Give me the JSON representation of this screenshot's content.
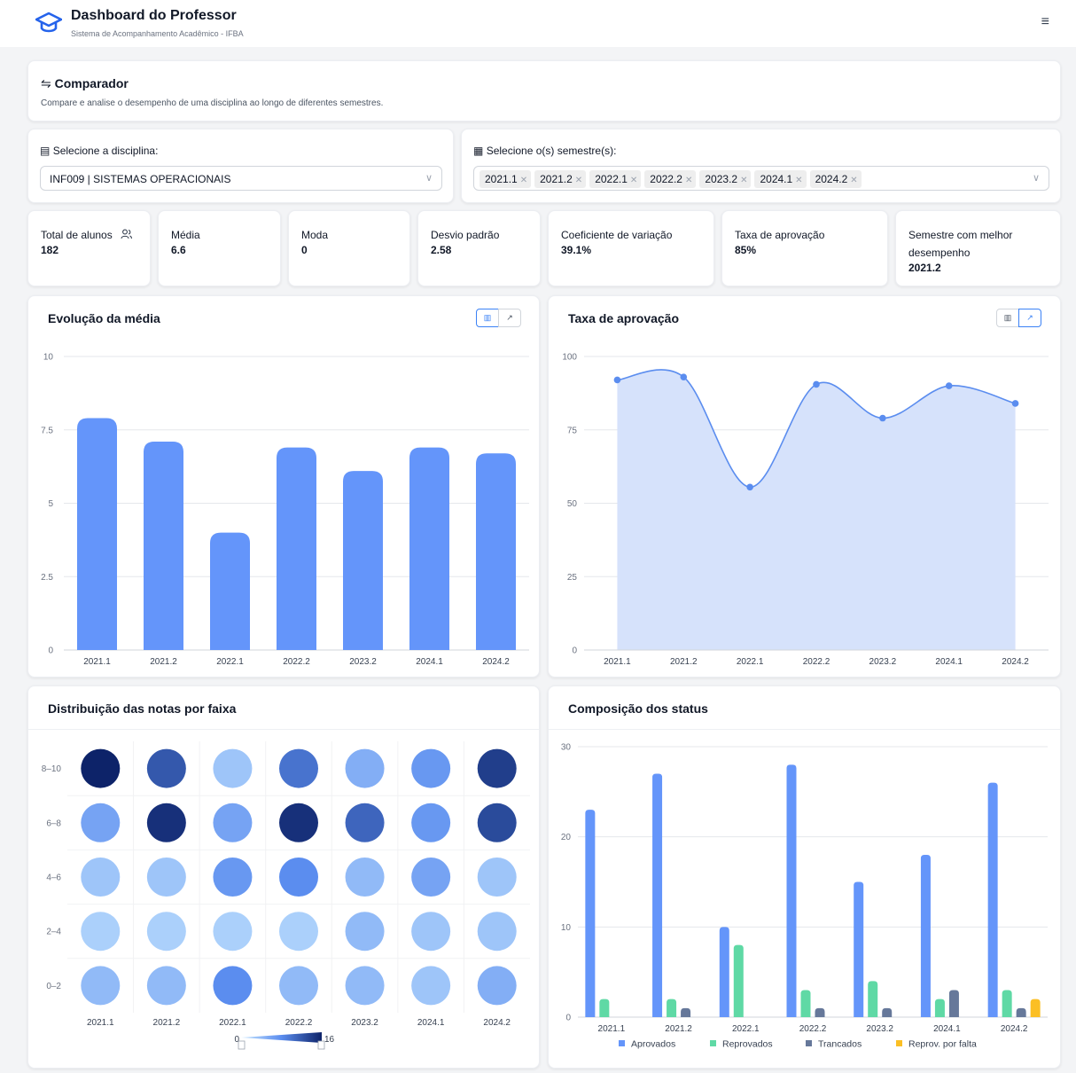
{
  "header": {
    "title": "Dashboard do Professor",
    "subtitle": "Sistema de Acompanhamento Acadêmico - IFBA",
    "menu_icon": "≡"
  },
  "comparador": {
    "icon": "⇋",
    "title": "Comparador",
    "subtitle": "Compare e analise o desempenho de uma disciplina ao longo de diferentes semestres."
  },
  "discipline": {
    "icon": "▤",
    "label": "Selecione a disciplina:",
    "value": "INF009 | SISTEMAS OPERACIONAIS"
  },
  "semesters": {
    "icon": "▦",
    "label": "Selecione o(s) semestre(s):",
    "selected": [
      "2021.1",
      "2021.2",
      "2022.1",
      "2022.2",
      "2023.2",
      "2024.1",
      "2024.2"
    ]
  },
  "stats": [
    {
      "label": "Total de alunos",
      "value": "182"
    },
    {
      "label": "Média",
      "value": "6.6"
    },
    {
      "label": "Moda",
      "value": "0"
    },
    {
      "label": "Desvio padrão",
      "value": "2.58"
    },
    {
      "label": "Coeficiente de variação",
      "value": "39.1%"
    },
    {
      "label": "Taxa de aprovação",
      "value": "85%"
    },
    {
      "label": "Semestre com melhor desempenho",
      "value": "2021.2"
    }
  ],
  "panels": {
    "media_title": "Evolução da média",
    "aprov_title": "Taxa de aprovação",
    "dist_title": "Distribuição das notas por faixa",
    "status_title": "Composição dos status"
  },
  "colors": {
    "bar": "#6495fa",
    "green": "#5fd9a5",
    "slate": "#66789a",
    "amber": "#fbbf24",
    "area": "#d6e2fb",
    "line": "#5b8def"
  },
  "chart_data": [
    {
      "type": "bar",
      "title": "Evolução da média",
      "categories": [
        "2021.1",
        "2021.2",
        "2022.1",
        "2022.2",
        "2023.2",
        "2024.1",
        "2024.2"
      ],
      "values": [
        7.9,
        7.1,
        4.0,
        6.9,
        6.1,
        6.9,
        6.7
      ],
      "ylim": [
        0,
        10
      ],
      "yticks": [
        "0",
        "2.5",
        "5",
        "7.5",
        "10"
      ],
      "grid": true
    },
    {
      "type": "area",
      "title": "Taxa de aprovação",
      "categories": [
        "2021.1",
        "2021.2",
        "2022.1",
        "2022.2",
        "2023.2",
        "2024.1",
        "2024.2"
      ],
      "values": [
        92,
        93,
        55.5,
        90.5,
        79,
        90,
        84
      ],
      "ylim": [
        0,
        100
      ],
      "yticks": [
        "0",
        "25",
        "50",
        "75",
        "100"
      ],
      "grid": true
    },
    {
      "type": "heatmap",
      "title": "Distribuição das notas por faixa",
      "x": [
        "2021.1",
        "2021.2",
        "2022.1",
        "2022.2",
        "2023.2",
        "2024.1",
        "2024.2"
      ],
      "y": [
        "8–10",
        "6–8",
        "4–6",
        "2–4",
        "0–2"
      ],
      "values": [
        [
          16,
          12,
          3,
          10,
          5,
          7,
          14
        ],
        [
          6,
          15,
          6,
          15,
          11,
          7,
          13
        ],
        [
          3,
          3,
          7,
          8,
          4,
          6,
          3
        ],
        [
          2,
          2,
          2,
          2,
          4,
          3,
          3
        ],
        [
          4,
          4,
          8,
          4,
          4,
          3,
          5
        ]
      ],
      "scale_min": "0",
      "scale_max": "16"
    },
    {
      "type": "bar",
      "title": "Composição dos status",
      "categories": [
        "2021.1",
        "2021.2",
        "2022.1",
        "2022.2",
        "2023.2",
        "2024.1",
        "2024.2"
      ],
      "series": [
        {
          "name": "Aprovados",
          "values": [
            23,
            27,
            10,
            28,
            15,
            18,
            26
          ]
        },
        {
          "name": "Reprovados",
          "values": [
            2,
            2,
            8,
            3,
            4,
            2,
            3
          ]
        },
        {
          "name": "Trancados",
          "values": [
            0,
            1,
            0,
            1,
            1,
            3,
            1
          ]
        },
        {
          "name": "Reprov. por falta",
          "values": [
            0,
            0,
            0,
            0,
            0,
            0,
            2
          ]
        }
      ],
      "ylim": [
        0,
        30
      ],
      "yticks": [
        "0",
        "10",
        "20",
        "30"
      ],
      "legend": "bottom",
      "grid": true
    }
  ]
}
